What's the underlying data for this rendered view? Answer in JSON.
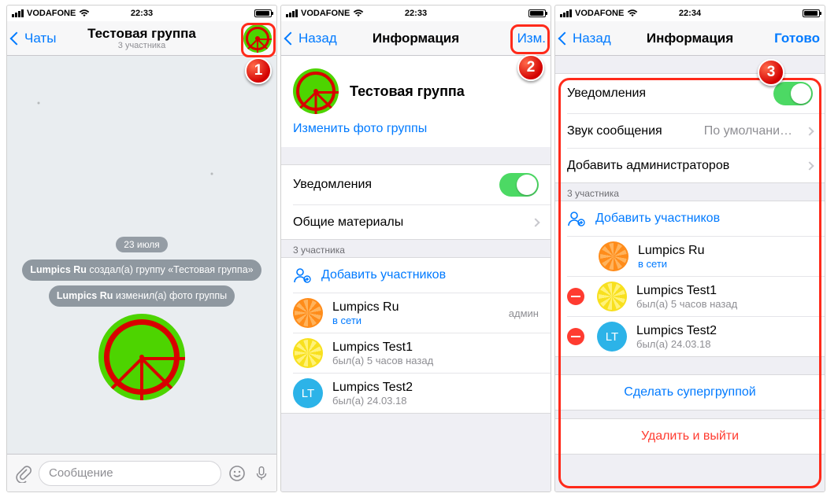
{
  "status": {
    "carrier": "VODAFONE"
  },
  "screen1": {
    "time": "22:33",
    "back": "Чаты",
    "title": "Тестовая группа",
    "subtitle": "3 участника",
    "date": "23 июля",
    "sys1_user": "Lumpics Ru",
    "sys1_text": " создал(а) группу «Тестовая группа»",
    "sys2_user": "Lumpics Ru",
    "sys2_text": " изменил(а) фото группы",
    "input_placeholder": "Сообщение"
  },
  "screen2": {
    "time": "22:33",
    "back": "Назад",
    "title": "Информация",
    "action": "Изм.",
    "group_name": "Тестовая группа",
    "change_photo": "Изменить фото группы",
    "notifications": "Уведомления",
    "shared": "Общие материалы",
    "members_header": "3 участника",
    "add_members": "Добавить участников",
    "admin_label": "админ",
    "members": [
      {
        "name": "Lumpics Ru",
        "status": "в сети",
        "online": true,
        "avatar": "orange"
      },
      {
        "name": "Lumpics Test1",
        "status": "был(а) 5 часов назад",
        "online": false,
        "avatar": "lemon"
      },
      {
        "name": "Lumpics Test2",
        "status": "был(а) 24.03.18",
        "online": false,
        "avatar": "lt",
        "initials": "LT"
      }
    ]
  },
  "screen3": {
    "time": "22:34",
    "back": "Назад",
    "title": "Информация",
    "action": "Готово",
    "notifications": "Уведомления",
    "sound": "Звук сообщения",
    "sound_value": "По умолчани…",
    "add_admins": "Добавить администраторов",
    "members_header": "3 участника",
    "add_members": "Добавить участников",
    "members": [
      {
        "name": "Lumpics Ru",
        "status": "в сети",
        "online": true,
        "avatar": "orange",
        "deletable": false
      },
      {
        "name": "Lumpics Test1",
        "status": "был(а) 5 часов назад",
        "online": false,
        "avatar": "lemon",
        "deletable": true
      },
      {
        "name": "Lumpics Test2",
        "status": "был(а) 24.03.18",
        "online": false,
        "avatar": "lt",
        "initials": "LT",
        "deletable": true
      }
    ],
    "supergroup": "Сделать супергруппой",
    "delete_leave": "Удалить и выйти"
  },
  "steps": {
    "s1": "1",
    "s2": "2",
    "s3": "3"
  }
}
